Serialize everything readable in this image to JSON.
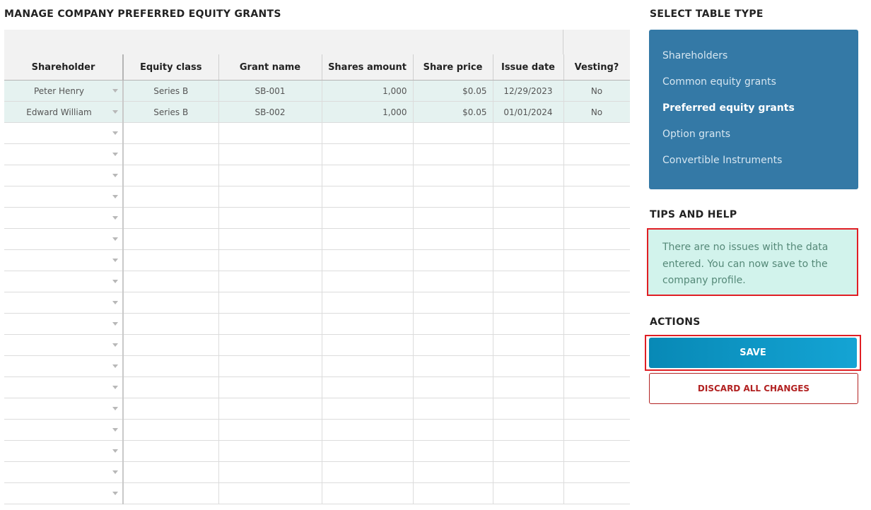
{
  "page_title": "MANAGE COMPANY PREFERRED EQUITY GRANTS",
  "grid": {
    "columns": [
      "Shareholder",
      "Equity class",
      "Grant name",
      "Shares amount",
      "Share price",
      "Issue date",
      "Vesting?"
    ],
    "rows": [
      {
        "shareholder": "Peter Henry",
        "equity_class": "Series B",
        "grant_name": "SB-001",
        "shares_amount": "1,000",
        "share_price": "$0.05",
        "issue_date": "12/29/2023",
        "vesting": "No"
      },
      {
        "shareholder": "Edward William",
        "equity_class": "Series B",
        "grant_name": "SB-002",
        "shares_amount": "1,000",
        "share_price": "$0.05",
        "issue_date": "01/01/2024",
        "vesting": "No"
      }
    ]
  },
  "sidebar": {
    "table_type_heading": "SELECT TABLE TYPE",
    "table_types": [
      {
        "label": "Shareholders",
        "active": false
      },
      {
        "label": "Common equity grants",
        "active": false
      },
      {
        "label": "Preferred equity grants",
        "active": true
      },
      {
        "label": "Option grants",
        "active": false
      },
      {
        "label": "Convertible Instruments",
        "active": false
      }
    ],
    "tips_heading": "TIPS AND HELP",
    "tips_text": "There are no issues with the data entered. You can now save to the company profile.",
    "actions_heading": "ACTIONS",
    "save_label": "SAVE",
    "discard_label": "DISCARD ALL CHANGES"
  },
  "colors": {
    "panel_blue": "#3479a6",
    "save_blue": "#0f97c6",
    "tips_bg": "#d2f3ec",
    "highlight_red": "#e01e24",
    "discard_red": "#b22222",
    "filled_row": "#e5f2f0"
  }
}
